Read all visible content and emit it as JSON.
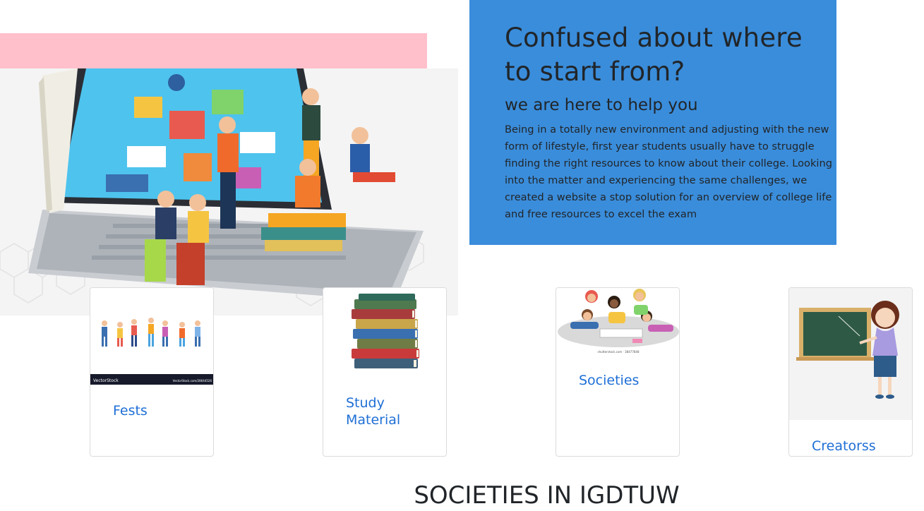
{
  "info": {
    "title": "Confused about where to start from?",
    "subtitle": "we are here to help you",
    "body": "Being in a totally new environment and adjusting with the new form of lifestyle, first year students usually have to struggle finding the right resources to know about their college. Looking into the matter and experiencing the same challenges, we created a website a stop solution for an overview of college life and free resources to excel the exam",
    "bg_color": "#3a8ddb"
  },
  "accent": {
    "pink_bar": "#ffc0cb",
    "link_color": "#1f6fd6"
  },
  "hero_image": {
    "icon": "students-on-laptop-illustration"
  },
  "cards": [
    {
      "label": "Fests",
      "icon": "dancing-people-illustration",
      "watermark_left": "VectorStock",
      "watermark_right": "VectorStock.com/28644526"
    },
    {
      "label": "Study Material",
      "icon": "book-stack-illustration"
    },
    {
      "label": "Societies",
      "icon": "children-drawing-illustration",
      "watermark": "shutterstock.com · 38477848"
    },
    {
      "label": "Creatorss",
      "icon": "teacher-at-chalkboard-illustration"
    }
  ],
  "section": {
    "title": "SOCIETIES IN IGDTUW"
  }
}
